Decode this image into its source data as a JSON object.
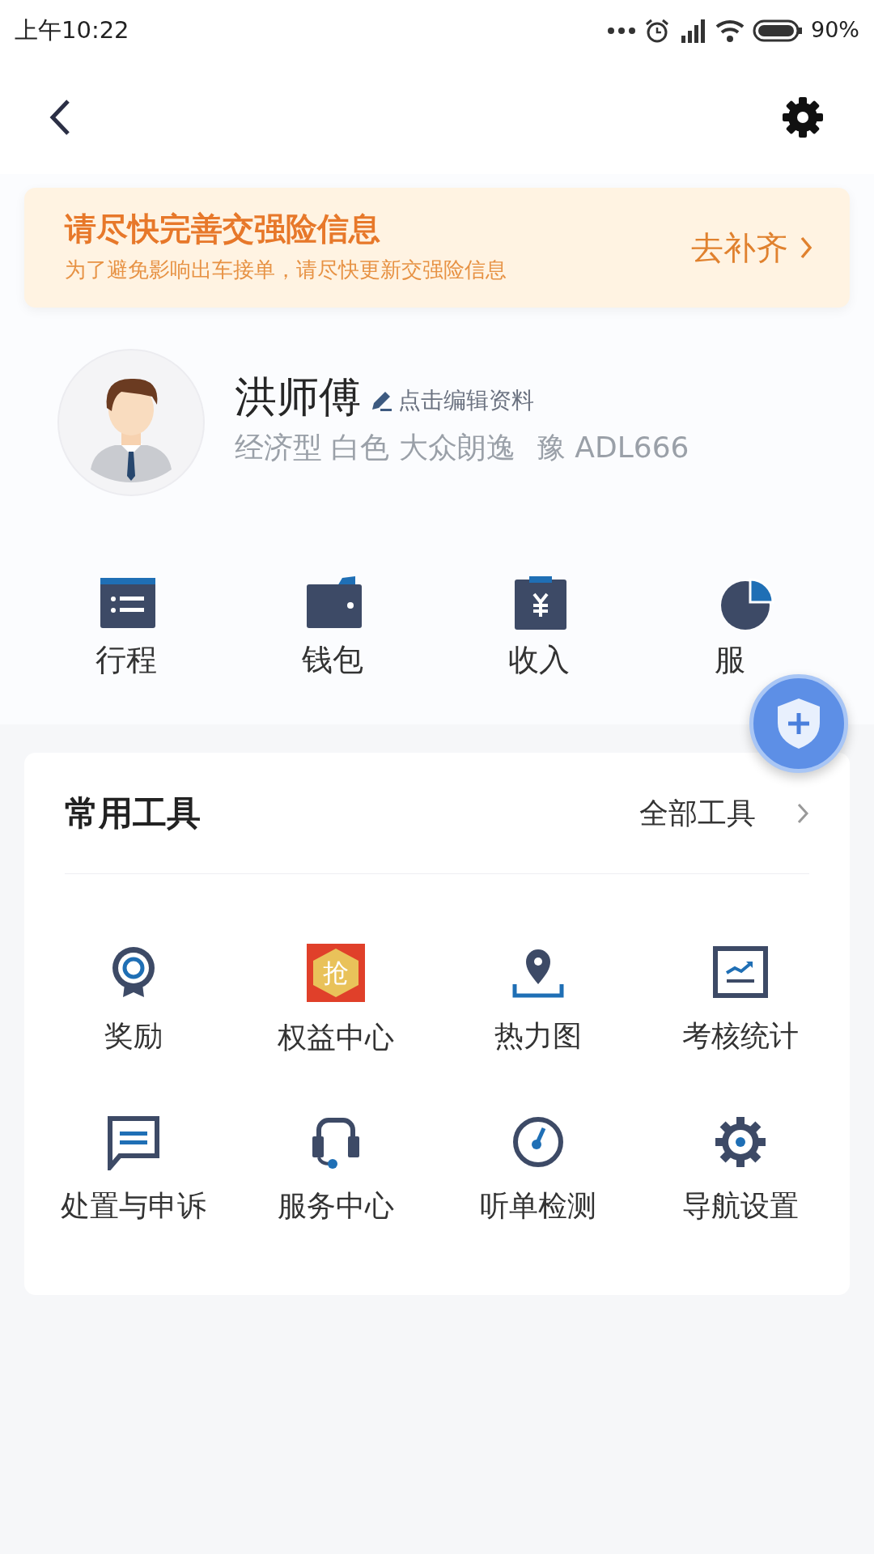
{
  "status_bar": {
    "time": "上午10:22",
    "battery": "90%"
  },
  "banner": {
    "title": "请尽快完善交强险信息",
    "subtitle": "为了避免影响出车接单，请尽快更新交强险信息",
    "action": "去补齐"
  },
  "profile": {
    "name": "洪师傅",
    "edit_link": "点击编辑资料",
    "vehicle": "经济型 白色 大众朗逸",
    "plate": "豫 ADL666"
  },
  "shortcuts": [
    {
      "kind": "trips",
      "label": "行程"
    },
    {
      "kind": "wallet",
      "label": "钱包"
    },
    {
      "kind": "income",
      "label": "收入"
    },
    {
      "kind": "service",
      "label": "服"
    }
  ],
  "tools": {
    "title": "常用工具",
    "all_link": "全部工具",
    "items": [
      {
        "kind": "reward",
        "label": "奖励"
      },
      {
        "kind": "grab",
        "label": "权益中心",
        "icon_text": "抢"
      },
      {
        "kind": "heatmap",
        "label": "热力图"
      },
      {
        "kind": "stats",
        "label": "考核统计"
      },
      {
        "kind": "message",
        "label": "处置与申诉"
      },
      {
        "kind": "headset",
        "label": "服务中心"
      },
      {
        "kind": "gauge",
        "label": "听单检测"
      },
      {
        "kind": "gear",
        "label": "导航设置"
      }
    ]
  }
}
